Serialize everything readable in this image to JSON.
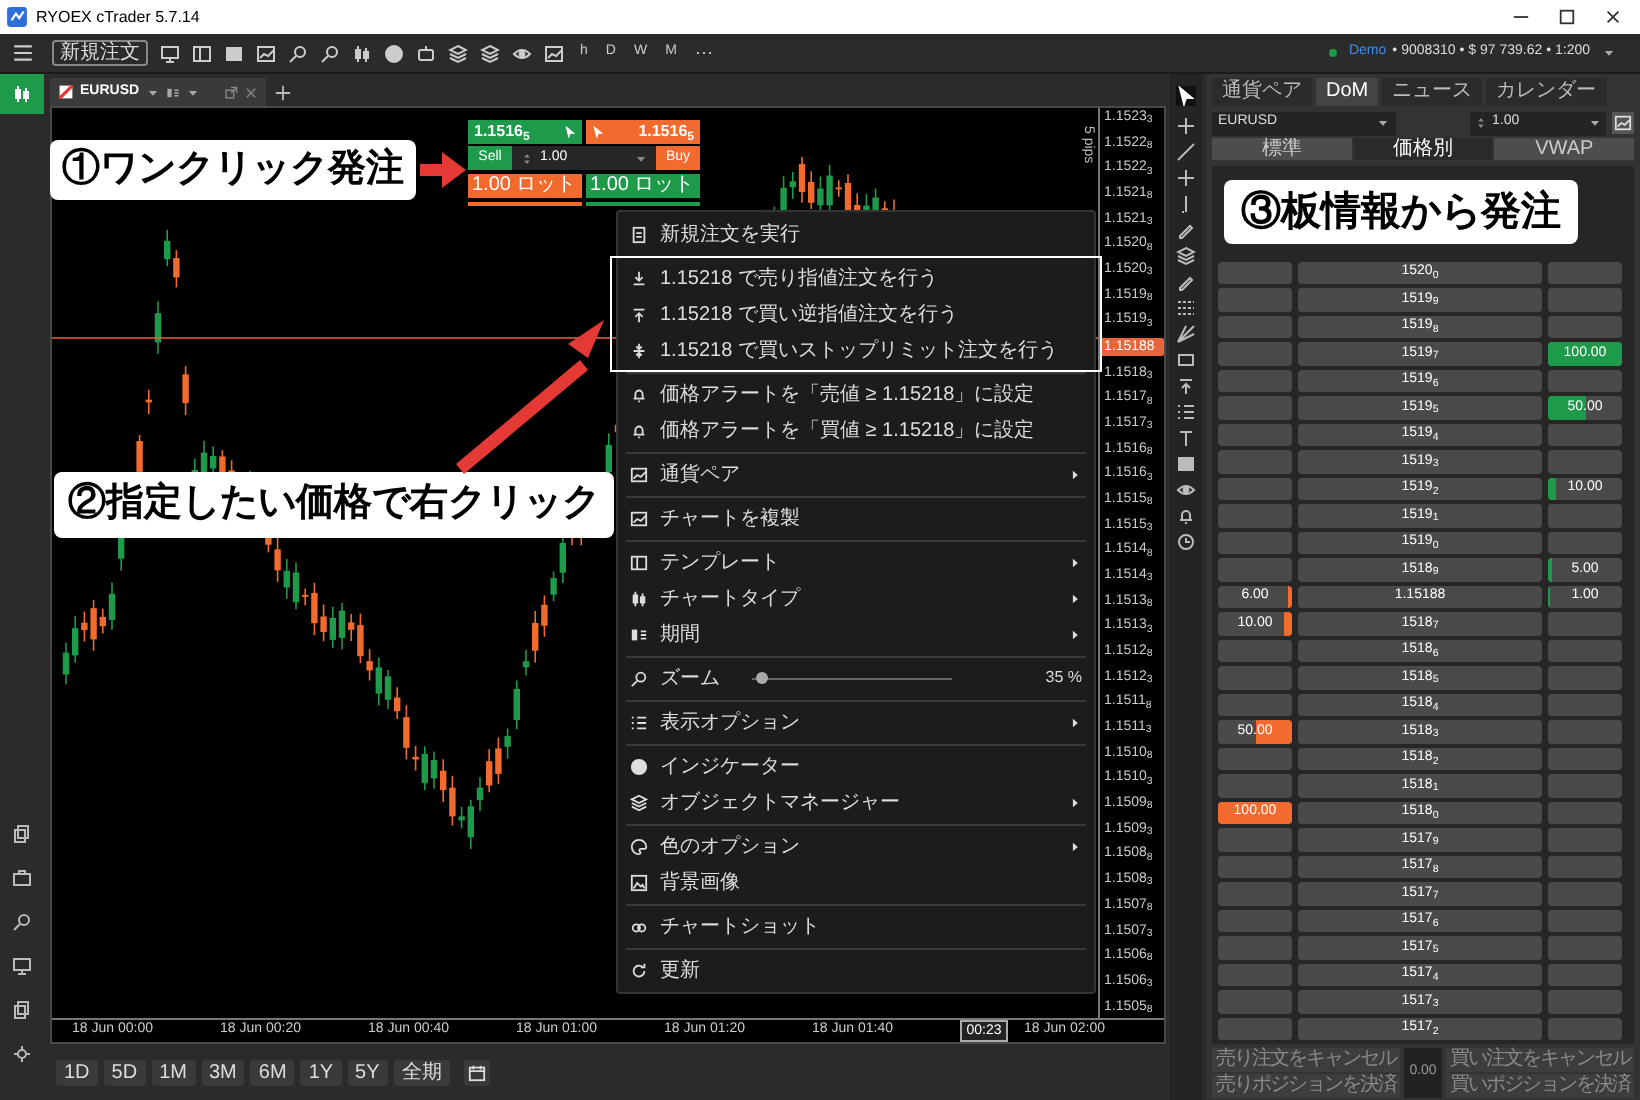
{
  "window": {
    "title": "RYOEX cTrader 5.7.14"
  },
  "toolbar": {
    "new_order": "新規注文",
    "periods": [
      "h",
      "D",
      "W",
      "M"
    ],
    "more": "⋯",
    "account": {
      "mode": "Demo",
      "details": "• 9008310 • $ 97 739.62 • 1:200"
    }
  },
  "chart_tab": {
    "symbol": "EURUSD"
  },
  "quick_trade": {
    "sell_price": "1.1516$_{5}$",
    "buy_price": "1.1516$_{5}$",
    "sell_label": "Sell",
    "buy_label": "Buy",
    "quantity": "1.00",
    "sell_lots": "1.00 ロット",
    "buy_lots": "1.00 ロット"
  },
  "chart": {
    "range_label": "5 pips",
    "price_labels_above": [
      "1.1523$_{3}$",
      "1.1522$_{8}$",
      "1.1522$_{3}$",
      "1.1521$_{8}$",
      "1.1521$_{3}$",
      "1.1520$_{8}$",
      "1.1520$_{3}$",
      "1.1519$_{8}$",
      "1.1519$_{3}$"
    ],
    "current_price": "1.15188",
    "price_labels_below": [
      "1.1518$_{3}$",
      "1.1517$_{8}$",
      "1.1517$_{3}$",
      "1.1516$_{8}$",
      "1.1516$_{3}$",
      "1.1515$_{8}$",
      "1.1515$_{3}$",
      "1.1514$_{8}$",
      "1.1514$_{3}$",
      "1.1513$_{8}$",
      "1.1513$_{3}$",
      "1.1512$_{8}$",
      "1.1512$_{3}$",
      "1.1511$_{8}$",
      "1.1511$_{3}$",
      "1.1510$_{8}$",
      "1.1510$_{3}$",
      "1.1509$_{8}$",
      "1.1509$_{3}$",
      "1.1508$_{8}$",
      "1.1508$_{3}$",
      "1.1507$_{8}$",
      "1.1507$_{3}$",
      "1.1506$_{8}$",
      "1.1506$_{3}$",
      "1.1505$_{8}$"
    ],
    "time_labels": [
      "18 Jun 00:00",
      "18 Jun 00:20",
      "18 Jun 00:40",
      "18 Jun 01:00",
      "18 Jun 01:20",
      "18 Jun 01:40"
    ],
    "cursor_time": "00:23",
    "last_time_label": "18 Jun 02:00"
  },
  "context_menu": {
    "groups": [
      [
        {
          "kind": "item",
          "label": "新規注文を実行",
          "submenu": false
        }
      ],
      [
        {
          "kind": "item",
          "label": "1.15218 で売り指値注文を行う",
          "submenu": false
        },
        {
          "kind": "item",
          "label": "1.15218 で買い逆指値注文を行う",
          "submenu": false
        },
        {
          "kind": "item",
          "label": "1.15218 で買いストップリミット注文を行う",
          "submenu": false
        }
      ],
      [
        {
          "kind": "item",
          "label": "価格アラートを「売値 ≥ 1.15218」に設定",
          "submenu": false
        },
        {
          "kind": "item",
          "label": "価格アラートを「買値 ≥ 1.15218」に設定",
          "submenu": false
        }
      ],
      [
        {
          "kind": "item",
          "label": "通貨ペア",
          "submenu": true
        }
      ],
      [
        {
          "kind": "item",
          "label": "チャートを複製",
          "submenu": false
        }
      ],
      [
        {
          "kind": "item",
          "label": "テンプレート",
          "submenu": true
        },
        {
          "kind": "item",
          "label": "チャートタイプ",
          "submenu": true
        },
        {
          "kind": "item",
          "label": "期間",
          "submenu": true
        }
      ],
      [
        {
          "kind": "slider",
          "label": "ズーム",
          "level": 0.05,
          "reading": "35 %"
        }
      ],
      [
        {
          "kind": "item",
          "label": "表示オプション",
          "submenu": true
        }
      ],
      [
        {
          "kind": "item",
          "label": "インジケーター",
          "submenu": false
        },
        {
          "kind": "item",
          "label": "オブジェクトマネージャー",
          "submenu": true
        }
      ],
      [
        {
          "kind": "item",
          "label": "色のオプション",
          "submenu": true
        },
        {
          "kind": "item",
          "label": "背景画像",
          "submenu": false
        }
      ],
      [
        {
          "kind": "item",
          "label": "チャートショット",
          "submenu": false
        }
      ],
      [
        {
          "kind": "item",
          "label": "更新",
          "submenu": false
        }
      ]
    ]
  },
  "timeframes": [
    "1D",
    "5D",
    "1M",
    "3M",
    "6M",
    "1Y",
    "5Y",
    "全期"
  ],
  "dom": {
    "tabs": [
      {
        "label": "通貨ペア",
        "selected": false
      },
      {
        "label": "DoM",
        "selected": true
      },
      {
        "label": "ニュース",
        "selected": false
      },
      {
        "label": "カレンダー",
        "selected": false
      }
    ],
    "symbol": "EURUSD",
    "quantity": "1.00",
    "views": [
      {
        "label": "標準",
        "selected": false
      },
      {
        "label": "価格別",
        "selected": true
      },
      {
        "label": "VWAP",
        "selected": false
      }
    ],
    "rows": [
      {
        "price": "1520$_{0}$"
      },
      {
        "price": "1519$_{9}$"
      },
      {
        "price": "1519$_{8}$"
      },
      {
        "price": "1519$_{7}$",
        "buy": {
          "volume": "100.00",
          "level": 1
        }
      },
      {
        "price": "1519$_{6}$"
      },
      {
        "price": "1519$_{5}$",
        "buy": {
          "volume": "50.00",
          "level": 0.5
        }
      },
      {
        "price": "1519$_{4}$"
      },
      {
        "price": "1519$_{3}$"
      },
      {
        "price": "1519$_{2}$",
        "buy": {
          "volume": "10.00",
          "level": 0.1
        }
      },
      {
        "price": "1519$_{1}$"
      },
      {
        "price": "1519$_{0}$"
      },
      {
        "price": "1518$_{9}$",
        "buy": {
          "volume": "5.00",
          "level": 0.05
        }
      },
      {
        "price": "1.15188",
        "sell": {
          "volume": "6.00",
          "level": 0.06
        },
        "buy": {
          "volume": "1.00",
          "level": 0.02
        }
      },
      {
        "price": "1518$_{7}$",
        "sell": {
          "volume": "10.00",
          "level": 0.1
        }
      },
      {
        "price": "1518$_{6}$"
      },
      {
        "price": "1518$_{5}$"
      },
      {
        "price": "1518$_{4}$"
      },
      {
        "price": "1518$_{3}$",
        "sell": {
          "volume": "50.00",
          "level": 0.5
        }
      },
      {
        "price": "1518$_{2}$"
      },
      {
        "price": "1518$_{1}$"
      },
      {
        "price": "1518$_{0}$",
        "sell": {
          "volume": "100.00",
          "level": 1
        }
      },
      {
        "price": "1517$_{9}$"
      },
      {
        "price": "1517$_{8}$"
      },
      {
        "price": "1517$_{7}$"
      },
      {
        "price": "1517$_{6}$"
      },
      {
        "price": "1517$_{5}$"
      },
      {
        "price": "1517$_{4}$"
      },
      {
        "price": "1517$_{3}$"
      },
      {
        "price": "1517$_{2}$"
      }
    ],
    "footer": {
      "sell_cancel": "売り注文をキャンセル",
      "sell_close": "売りポジションを決済",
      "spread": "0.00",
      "buy_cancel": "買い注文をキャンセル",
      "buy_close": "買いポジションを決済"
    }
  },
  "annotations": [
    {
      "text": "①ワンクリック発注"
    },
    {
      "text": "②指定したい価格で右クリック"
    },
    {
      "text": "③板情報から発注"
    }
  ]
}
